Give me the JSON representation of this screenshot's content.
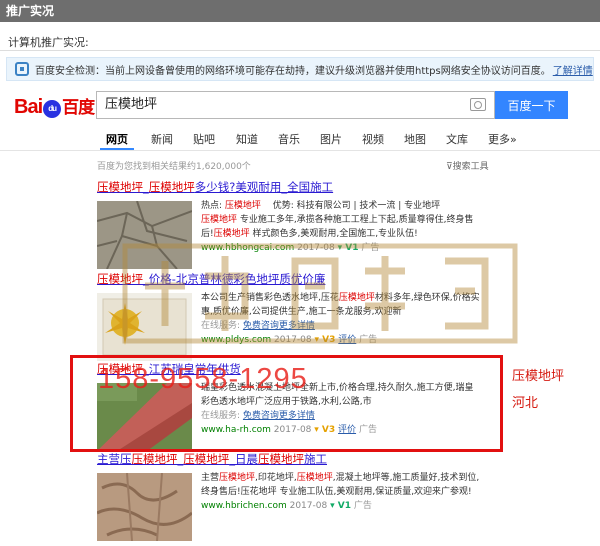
{
  "header": {
    "title": "推广实况"
  },
  "caption": "计算机推广实况:",
  "warning": {
    "text": "百度安全检测：当前上网设备曾使用的网络环境可能存在劫持，建议升级浏览器并使用https网络安全协议访问百度。",
    "link": "了解详情"
  },
  "search": {
    "logo_left": "Bai",
    "logo_paw": "du",
    "logo_right": "百度",
    "query": "压模地坪",
    "button": "百度一下"
  },
  "tabs": [
    "网页",
    "新闻",
    "贴吧",
    "知道",
    "音乐",
    "图片",
    "视频",
    "地图",
    "文库",
    "更多»"
  ],
  "stats": "百度为您找到相关结果约1,620,000个",
  "tools": "搜索工具",
  "results": [
    {
      "title": "压模地坪_压模地坪多少钱?美观耐用_全国施工",
      "line1": "热点: 压模地坪　 优势: 科技有限公司 | 技术一流 | 专业地坪",
      "line2": "压模地坪 专业施工多年,承揽各种施工工程上下起,质量尊得住,终身售",
      "line3": "后!压模地坪 样式颜色多,美观耐用,全国施工,专业队伍!",
      "url": "www.hbhongcai.com",
      "date": "2017-08",
      "ad": "广告"
    },
    {
      "title": "压模地坪_价格-北京普林德彩色地坪质优价廉",
      "line1": "本公司生产销售彩色透水地坪,压花压模地坪材料多年,绿色环保,价格实",
      "line2": "惠,质优价廉,公司提供生产,施工一条龙服务,欢迎新",
      "service": "在线服务:",
      "service_link": "免费咨询更多详情",
      "url": "www.pldys.com",
      "date": "2017-08",
      "review": "评价",
      "ad": "广告"
    },
    {
      "title": "压模地坪_江苏瑞皇常年供货",
      "line1": "瑞皇彩色透水混凝土地坪全新上市,价格合理,持久耐久,施工方便,瑞皇",
      "line2": "彩色透水地坪广泛应用于铁路,水利,公路,市",
      "service": "在线服务:",
      "service_link": "免费咨询更多详情",
      "url": "www.ha-rh.com",
      "date": "2017-08",
      "review": "评价",
      "ad": "广告"
    },
    {
      "title": "主营压压模地坪_压模地坪_日晨压模地坪施工",
      "line1": "主营压模地坪,印花地坪,压模地坪,混凝土地坪等,施工质量好,技术到位,",
      "line2": "终身售后!压花地坪 专业施工队伍,美观耐用,保证质量,欢迎来广参观!",
      "url": "www.hbrichen.com",
      "date": "2017-08",
      "ad": "广告"
    }
  ],
  "overlay": {
    "phone": "158-9558-1295",
    "side_text_1": "压模地坪",
    "side_text_2": "河北"
  }
}
